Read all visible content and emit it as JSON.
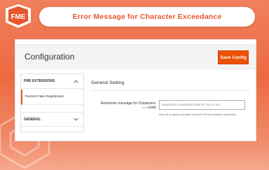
{
  "banner": {
    "title": "Error Message for Character Exceedance"
  },
  "colors": {
    "accent": "#eb5202",
    "brand": "#e8572c"
  },
  "logo": {
    "text": "FME"
  },
  "config": {
    "title": "Configuration",
    "save_label": "Save Config"
  },
  "sidebar": {
    "sections": [
      {
        "label": "FME EXTENSIONS",
        "icon": "chevron-up-icon",
        "expanded": true,
        "items": [
          {
            "label": "Restrict Fake Registration",
            "active": true
          }
        ]
      },
      {
        "label": "GENERAL",
        "icon": "chevron-down-icon",
        "expanded": false
      }
    ]
  },
  "main": {
    "section_title": "General Setting",
    "field": {
      "label": "Restriction message for Characters Limit",
      "scope": "[store view]",
      "placeholder": "Maximum characters limit for %2 is %1.",
      "note": "Use %1 to show character limit and %2 for restricted name field."
    }
  }
}
